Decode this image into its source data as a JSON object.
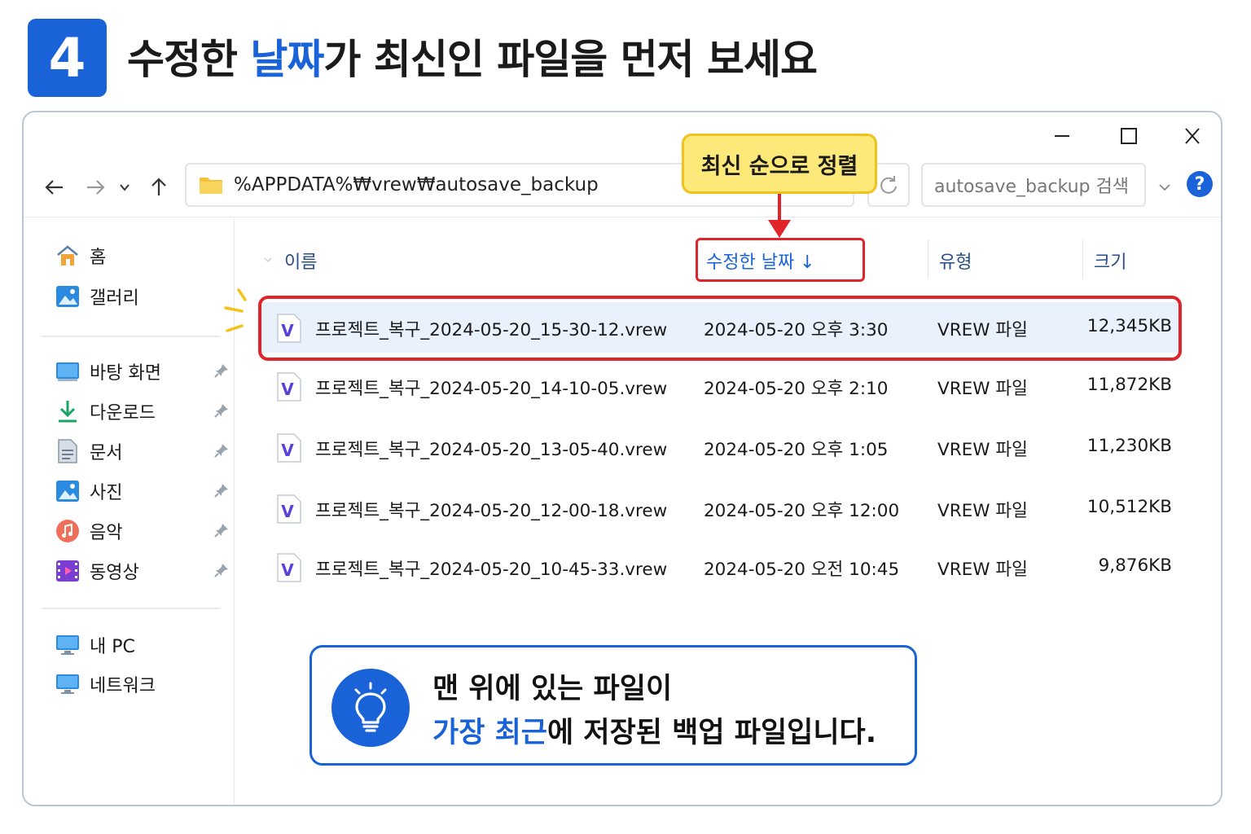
{
  "step": {
    "number": "4",
    "title_part1": "수정한 ",
    "title_highlight": "날짜",
    "title_part2": "가 최신인 파일을 먼저 보세요"
  },
  "toolbar": {
    "address_path": "%APPDATA%₩vrew₩autosave_backup",
    "search_placeholder": "autosave_backup 검색",
    "help_label": "?"
  },
  "callout": {
    "label": "최신 순으로 정렬"
  },
  "sidebar": {
    "quick": [
      {
        "label": "홈",
        "icon": "home-icon"
      },
      {
        "label": "갤러리",
        "icon": "gallery-icon"
      }
    ],
    "pinned": [
      {
        "label": "바탕 화면",
        "icon": "desktop-icon"
      },
      {
        "label": "다운로드",
        "icon": "download-icon"
      },
      {
        "label": "문서",
        "icon": "documents-icon"
      },
      {
        "label": "사진",
        "icon": "pictures-icon"
      },
      {
        "label": "음악",
        "icon": "music-icon"
      },
      {
        "label": "동영상",
        "icon": "videos-icon"
      }
    ],
    "devices": [
      {
        "label": "내 PC",
        "icon": "pc-icon"
      },
      {
        "label": "네트워크",
        "icon": "network-icon"
      }
    ]
  },
  "columns": {
    "name": "이름",
    "date": "수정한 날짜 ↓",
    "type": "유형",
    "size": "크기"
  },
  "files": [
    {
      "name": "프로젝트_복구_2024-05-20_15-30-12.vrew",
      "date": "2024-05-20 오후 3:30",
      "type": "VREW 파일",
      "size": "12,345KB"
    },
    {
      "name": "프로젝트_복구_2024-05-20_14-10-05.vrew",
      "date": "2024-05-20 오후 2:10",
      "type": "VREW 파일",
      "size": "11,872KB"
    },
    {
      "name": "프로젝트_복구_2024-05-20_13-05-40.vrew",
      "date": "2024-05-20 오후 1:05",
      "type": "VREW 파일",
      "size": "11,230KB"
    },
    {
      "name": "프로젝트_복구_2024-05-20_12-00-18.vrew",
      "date": "2024-05-20 오후 12:00",
      "type": "VREW 파일",
      "size": "10,512KB"
    },
    {
      "name": "프로젝트_복구_2024-05-20_10-45-33.vrew",
      "date": "2024-05-20 오전 10:45",
      "type": "VREW 파일",
      "size": "9,876KB"
    }
  ],
  "file_icon_letter": "V",
  "tip": {
    "line1": "맨 위에 있는 파일이",
    "line2_highlight": "가장 최근",
    "line2_rest": "에 저장된 백업 파일입니다."
  },
  "colors": {
    "accent": "#1a62d8",
    "highlight_red": "#e0242a",
    "callout_yellow": "#fde87a",
    "vrew_purple": "#5b3fd9"
  }
}
